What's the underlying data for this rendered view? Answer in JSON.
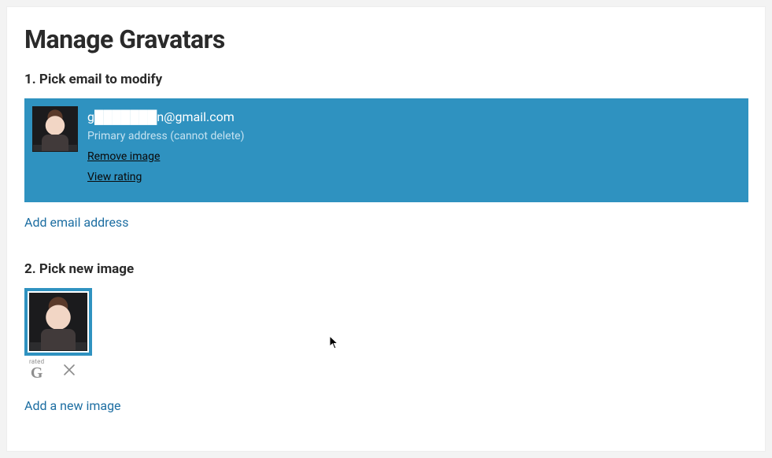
{
  "page": {
    "title": "Manage Gravatars"
  },
  "section1": {
    "heading": "1. Pick email to modify",
    "email": {
      "address": "g███████n@gmail.com",
      "subtext": "Primary address (cannot delete)",
      "remove_label": "Remove image",
      "view_rating_label": "View rating"
    },
    "add_email_label": "Add email address"
  },
  "section2": {
    "heading": "2. Pick new image",
    "rating": {
      "prefix": "rated",
      "letter": "G"
    },
    "add_image_label": "Add a new image"
  }
}
